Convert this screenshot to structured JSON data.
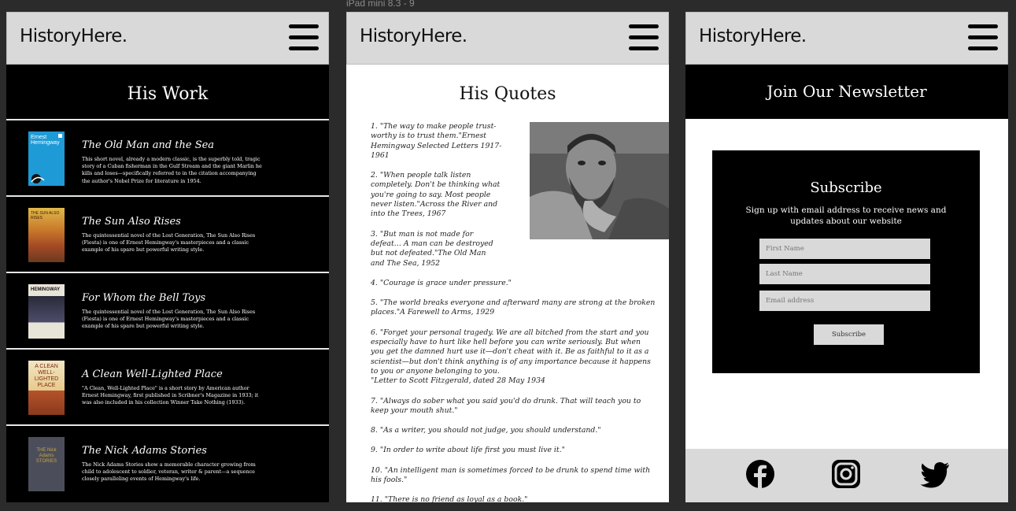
{
  "canvas": {
    "device_label": "iPad mini 8.3 - 9"
  },
  "colors": {
    "header_bg": "#d9d9d9",
    "dark": "#000000",
    "light": "#ffffff"
  },
  "header": {
    "logo": "HistoryHere.",
    "menu_icon": "hamburger-menu-icon"
  },
  "work": {
    "title": "His Work",
    "books": [
      {
        "title": "The Old Man and the Sea",
        "cover_text": "Ernest Hemingway",
        "description": "This short novel, already a modern classic, is the superbly told, tragic story of a Cuban fisherman in the Gulf Stream and the giant Marlin he kills and loses—specifically referred to in the citation accompanying the author's Nobel Prize for literature in 1954."
      },
      {
        "title": "The Sun Also Rises",
        "cover_text": "THE SUN ALSO RISES",
        "description": "The quintessential novel of the Lost Generation, The Sun Also Rises (Fiesta) is one of Ernest Hemingway's masterpieces and a classic example of his spare but powerful writing style."
      },
      {
        "title": "For Whom the Bell Toys",
        "cover_text": "HEMINGWAY",
        "description": "The quintessential novel of the Lost Generation, The Sun Also Rises (Fiesta) is one of Ernest Hemingway's masterpieces and a classic example of his spare but powerful writing style."
      },
      {
        "title": "A Clean Well-Lighted Place",
        "cover_text": "A CLEAN WELL-LIGHTED PLACE",
        "description": "\"A Clean, Well-Lighted Place\" is a short story by American author Ernest Hemingway, first published in Scribner's Magazine in 1933; it was also included in his collection Winner Take Nothing (1933)."
      },
      {
        "title": "The Nick Adams Stories",
        "cover_text": "THE Nick Adams STORIES",
        "description": "The Nick Adams Stories show a memorable character growing from child to adolescent to soldier, veteran, writer & parent—a sequence closely paralleling events of Hemingway's life."
      }
    ]
  },
  "quotes": {
    "title": "His Quotes",
    "items": [
      "1. \"The way to make people trust-worthy is to trust them.\"Ernest Hemingway Selected Letters 1917-1961",
      "2. \"When people talk listen completely. Don't be thinking what you're going to say. Most people never listen.\"Across the River and into the Trees, 1967",
      "3. \"But man is not made for defeat… A man can be destroyed but not defeated.\"The Old Man and The Sea, 1952",
      "4. \"Courage is grace under pressure.\"",
      "5. \"The world breaks everyone and afterward many are strong at the broken places.\"A Farewell to Arms, 1929",
      "6. \"Forget your personal tragedy. We are all bitched from the start and you especially have to hurt like hell before you can write seriously. But when you get the damned hurt use it—don't cheat with it. Be as faithful to it as a scientist—but don't think anything is of any importance because it happens to you or anyone belonging to you.\n\"Letter to Scott Fitzgerald, dated 28 May 1934",
      "7. \"Always do sober what you said you'd do drunk. That will teach you to keep your mouth shut.\"",
      "8. \"As a writer, you should not judge, you should understand.\"",
      "9. \"In order to write about life first you must live it.\"",
      "10. \"An intelligent man is sometimes forced to be drunk to spend time with his fools.\"",
      "11. \"There is no friend as loyal as a book.\""
    ]
  },
  "newsletter": {
    "banner_title": "Join Our Newsletter",
    "box_title": "Subscribe",
    "description": "Sign up with email address to receive news and updates about our website",
    "first_name_placeholder": "First Name",
    "last_name_placeholder": "Last Name",
    "email_placeholder": "Email address",
    "subscribe_label": "Subscribe"
  },
  "footer": {
    "icons": [
      "facebook-icon",
      "instagram-icon",
      "twitter-icon"
    ]
  }
}
